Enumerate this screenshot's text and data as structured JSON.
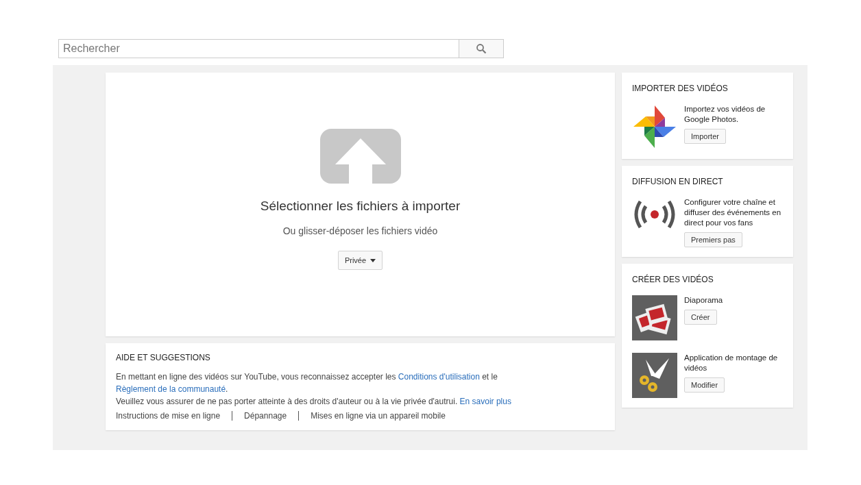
{
  "search": {
    "placeholder": "Rechercher"
  },
  "upload": {
    "title": "Sélectionner les fichiers à importer",
    "subtitle": "Ou glisser-déposer les fichiers vidéo",
    "privacy": "Privée"
  },
  "help": {
    "title": "AIDE ET SUGGESTIONS",
    "paragraphs": [
      [
        {
          "text": "En mettant en ligne des vidéos sur YouTube, vous reconnaissez accepter les ",
          "link": false
        },
        {
          "text": "Conditions d'utilisation",
          "link": true
        },
        {
          "text": " et le ",
          "link": false
        },
        {
          "text": "Règlement de la communauté",
          "link": true
        },
        {
          "text": ".",
          "link": false
        }
      ],
      [
        {
          "text": "Veuillez vous assurer de ne pas porter atteinte à des droits d'auteur ou à la vie privée d'autrui. ",
          "link": false
        },
        {
          "text": "En savoir plus",
          "link": true
        }
      ]
    ],
    "links": [
      "Instructions de mise en ligne",
      "Dépannage",
      "Mises en ligne via un appareil mobile"
    ]
  },
  "sidebar": [
    {
      "title": "IMPORTER DES VIDÉOS",
      "items": [
        {
          "kind": "photos",
          "text": "Importez vos vidéos de Google Photos.",
          "button": "Importer"
        }
      ]
    },
    {
      "title": "DIFFUSION EN DIRECT",
      "items": [
        {
          "kind": "live",
          "text": "Configurer votre chaîne et diffuser des événements en direct pour vos fans",
          "button": "Premiers pas"
        }
      ]
    },
    {
      "title": "CRÉER DES VIDÉOS",
      "items": [
        {
          "kind": "slides",
          "text": "Diaporama",
          "button": "Créer"
        },
        {
          "kind": "editor",
          "text": "Application de montage de vidéos",
          "button": "Modifier"
        }
      ]
    }
  ]
}
